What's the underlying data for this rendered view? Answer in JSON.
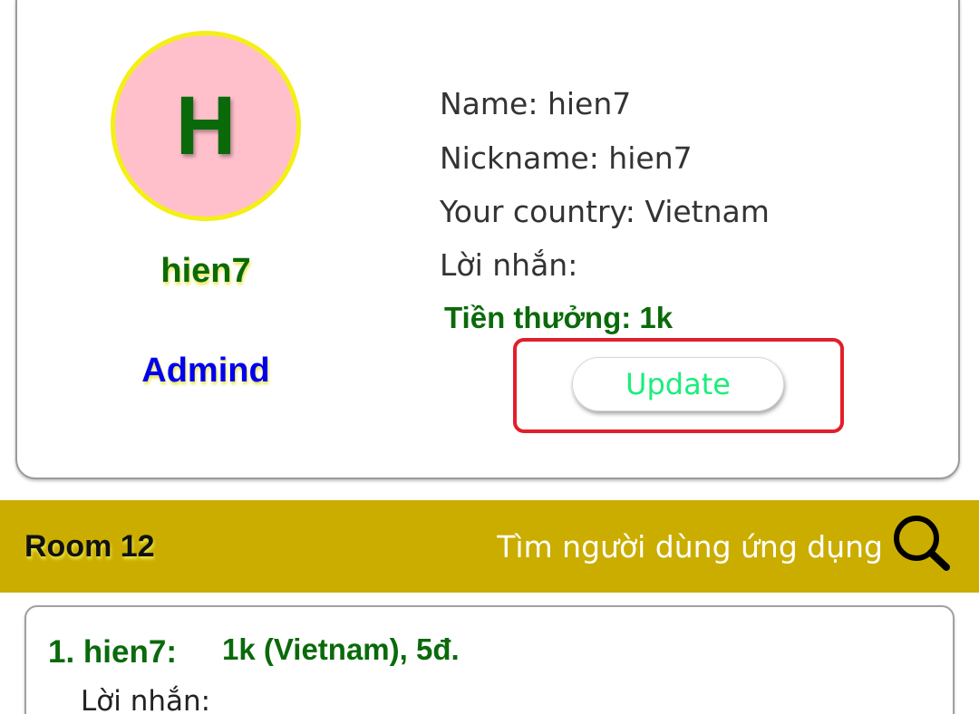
{
  "profile": {
    "avatar_letter": "H",
    "username": "hien7",
    "role": "Admind",
    "name_line": "Name: hien7",
    "nickname_line": "Nickname: hien7",
    "country_line": "Your country: Vietnam",
    "message_line": "Lời nhắn:",
    "reward_line": "Tiền thưởng: 1k",
    "update_label": "Update"
  },
  "room_bar": {
    "title": "Room 12",
    "search_label": "Tìm người dùng ứng dụng",
    "search_icon": "magnifier-icon"
  },
  "user_list": [
    {
      "rank_name": "1. hien7:",
      "detail": "1k (Vietnam), 5đ.",
      "message": "Lời nhắn:"
    }
  ],
  "colors": {
    "avatar_bg": "#ffc0cb",
    "avatar_border": "#f4ef14",
    "green_text": "#0a6a0a",
    "role_blue": "#0000ee",
    "update_text": "#1aee7a",
    "highlight_red": "#e0202a",
    "room_bar_bg": "#cbad00"
  }
}
